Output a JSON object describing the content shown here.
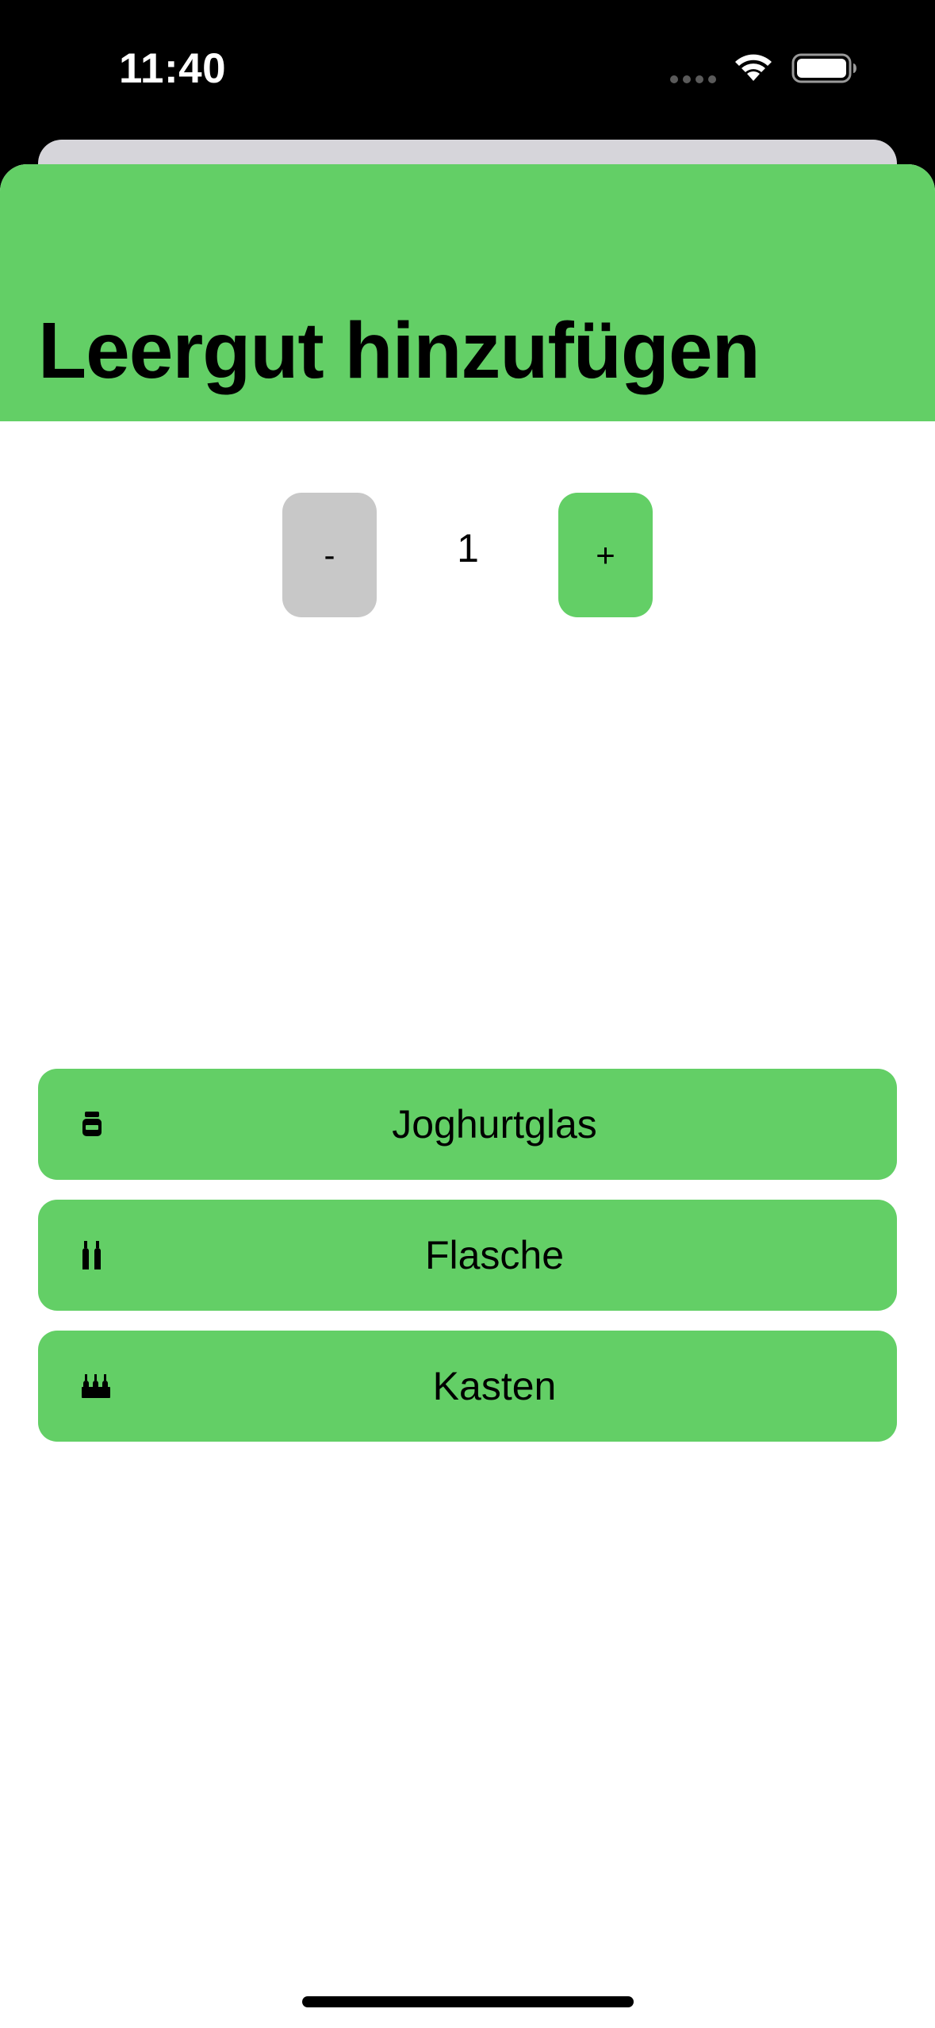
{
  "status_bar": {
    "time": "11:40",
    "wifi_icon": "wifi-icon",
    "battery_icon": "battery-icon"
  },
  "header": {
    "title": "Leergut hinzufügen",
    "color": "#63cf66"
  },
  "stepper": {
    "decrement_label": "-",
    "value": "1",
    "increment_label": "+",
    "decrement_color": "#c8c8c8",
    "increment_color": "#63cf66"
  },
  "types": [
    {
      "label": "Joghurtglas",
      "icon": "jar-icon"
    },
    {
      "label": "Flasche",
      "icon": "bottles-icon"
    },
    {
      "label": "Kasten",
      "icon": "crate-icon"
    }
  ],
  "accent_color": "#63cf66"
}
